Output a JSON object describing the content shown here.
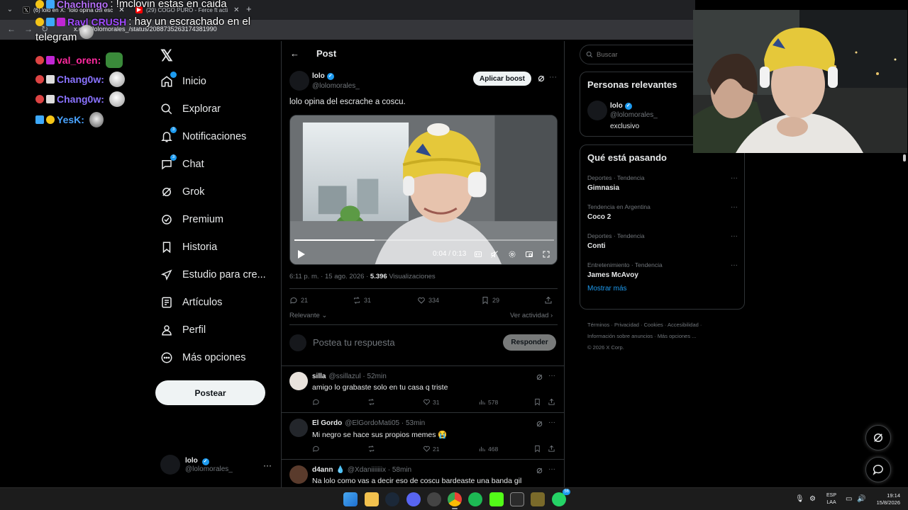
{
  "browser": {
    "tabs": [
      {
        "label": "(6) lolo en X: \"lolo opina del esc",
        "active": true
      },
      {
        "label": "(29) COGO PURO - Ferce ft acti",
        "active": false
      }
    ],
    "url_host": "x.com/lolomorales_/status/",
    "url_path": "2088735263174381990"
  },
  "stream_chat": [
    {
      "user": "Chachingo",
      "user_color": "#b46ff6",
      "message": ": !mclovin estas en caida",
      "emote": false
    },
    {
      "user": "Ravl CRUSH",
      "user_color": "#a04bff",
      "message": ": hay un escrachado en el",
      "emote": false
    },
    {
      "user": "",
      "user_color": "#ffffff",
      "message": "telegram",
      "emote": true
    },
    {
      "user": "val_oren:",
      "user_color": "#ff2aa0",
      "message": "",
      "emote": true
    },
    {
      "user": "Chang0w:",
      "user_color": "#8a73ff",
      "message": "",
      "emote": true
    },
    {
      "user": "Chang0w:",
      "user_color": "#8a73ff",
      "message": "",
      "emote": true
    },
    {
      "user": "YesK:",
      "user_color": "#4aa3ff",
      "message": "",
      "emote": true
    }
  ],
  "nav": {
    "items": [
      {
        "label": "Inicio",
        "icon": "home-icon",
        "badge": true
      },
      {
        "label": "Explorar",
        "icon": "search-icon",
        "badge": false
      },
      {
        "label": "Notificaciones",
        "icon": "bell-icon",
        "badge": true
      },
      {
        "label": "Chat",
        "icon": "chat-icon",
        "badge": true
      },
      {
        "label": "Grok",
        "icon": "grok-icon",
        "badge": false
      },
      {
        "label": "Premium",
        "icon": "verified-icon",
        "badge": false
      },
      {
        "label": "Historia",
        "icon": "bookmark-icon",
        "badge": false
      },
      {
        "label": "Estudio para cre...",
        "icon": "rocket-icon",
        "badge": false
      },
      {
        "label": "Artículos",
        "icon": "article-icon",
        "badge": false
      },
      {
        "label": "Perfil",
        "icon": "person-icon",
        "badge": false
      },
      {
        "label": "Más opciones",
        "icon": "more-circle-icon",
        "badge": false
      }
    ],
    "post_button": "Postear",
    "account_name": "lolo",
    "account_handle": "@lolomorales_"
  },
  "post": {
    "header_title": "Post",
    "author_name": "lolo",
    "author_handle": "@lolomorales_",
    "boost_button": "Aplicar boost",
    "text": "lolo opina del escrache a coscu.",
    "video_time": "0:04 / 0:13",
    "video_progress": 0.31,
    "time": "6:11 p. m. · 15 ago. 2026 · ",
    "views_count": "5.396",
    "views_label": " Visualizaciones",
    "replies": "21",
    "reposts": "31",
    "likes": "334",
    "bookmarks": "29",
    "sort_label": "Relevante",
    "activity_link": "Ver actividad",
    "reply_placeholder": "Postea tu respuesta",
    "reply_button": "Responder"
  },
  "comments": [
    {
      "name": "silla",
      "handle": "@ssillazul · 52min",
      "text": "amigo lo grabaste solo en tu casa q triste",
      "replies": "",
      "reposts": "",
      "likes": "31",
      "views": "578"
    },
    {
      "name": "El Gordo",
      "handle": "@ElGordoMati05 · 53min",
      "text": "Mi negro se hace sus propios memes 😭",
      "replies": "",
      "reposts": "",
      "likes": "21",
      "views": "468"
    },
    {
      "name": "d4ann",
      "handle": "@Xdaniiiiiiix · 58min",
      "text": "Na lolo como vas a decir eso de coscu bardeaste una banda gil",
      "replies": "",
      "reposts": "",
      "likes": "",
      "views": ""
    }
  ],
  "sidebar": {
    "search_placeholder": "Buscar",
    "relevant_title": "Personas relevantes",
    "relevant_name": "lolo",
    "relevant_handle": "@lolomorales_",
    "relevant_bio": "exclusivo",
    "trends_title": "Qué está pasando",
    "trends": [
      {
        "category": "Deportes · Tendencia",
        "name": "Gimnasia"
      },
      {
        "category": "Tendencia en Argentina",
        "name": "Coco 2"
      },
      {
        "category": "Deportes · Tendencia",
        "name": "Conti"
      },
      {
        "category": "Entretenimiento · Tendencia",
        "name": "James McAvoy"
      }
    ],
    "show_more": "Mostrar más",
    "footer": [
      "Términos",
      "Privacidad",
      "Cookies",
      "Accesibilidad",
      "Información sobre anuncios",
      "Más opciones ...",
      "© 2026 X Corp."
    ]
  },
  "taskbar": {
    "lang_top": "ESP",
    "lang_bottom": "LAA",
    "time": "19:14",
    "date": "15/8/2026",
    "whatsapp_badge": "56"
  },
  "colors": {
    "accent": "#1d9bf0",
    "background": "#000000",
    "border": "#2f3336",
    "muted": "#71767b"
  }
}
